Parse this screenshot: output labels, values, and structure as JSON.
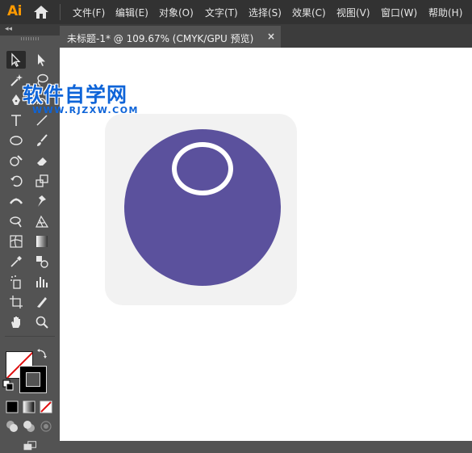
{
  "app": {
    "logo": "Ai"
  },
  "menu": [
    "文件(F)",
    "编辑(E)",
    "对象(O)",
    "文字(T)",
    "选择(S)",
    "效果(C)",
    "视图(V)",
    "窗口(W)",
    "帮助(H)"
  ],
  "tab": {
    "title": "未标题-1* @ 109.67% (CMYK/GPU 预览)",
    "close": "×"
  },
  "toolbar": {
    "collapse": "◂◂",
    "tools": [
      "selection-tool-icon",
      "direct-selection-tool-icon",
      "magic-wand-tool-icon",
      "lasso-tool-icon",
      "pen-tool-icon",
      "curvature-tool-icon",
      "type-tool-icon",
      "line-segment-tool-icon",
      "ellipse-tool-icon",
      "paintbrush-tool-icon",
      "shaper-tool-icon",
      "eraser-tool-icon",
      "rotate-tool-icon",
      "scale-tool-icon",
      "width-tool-icon",
      "puppet-warp-tool-icon",
      "shape-builder-tool-icon",
      "perspective-grid-tool-icon",
      "mesh-tool-icon",
      "gradient-tool-icon",
      "eyedropper-tool-icon",
      "blend-tool-icon",
      "symbol-sprayer-tool-icon",
      "column-graph-tool-icon",
      "artboard-tool-icon",
      "slice-tool-icon",
      "hand-tool-icon",
      "zoom-tool-icon"
    ]
  },
  "watermark": {
    "title": "软件自学网",
    "subtitle": "WWW.RJZXW.COM"
  },
  "colors": {
    "artboard_bg": "#f2f2f2",
    "circle": "#5b519d",
    "ring": "#ffffff",
    "watermark": "#0e64d8"
  }
}
